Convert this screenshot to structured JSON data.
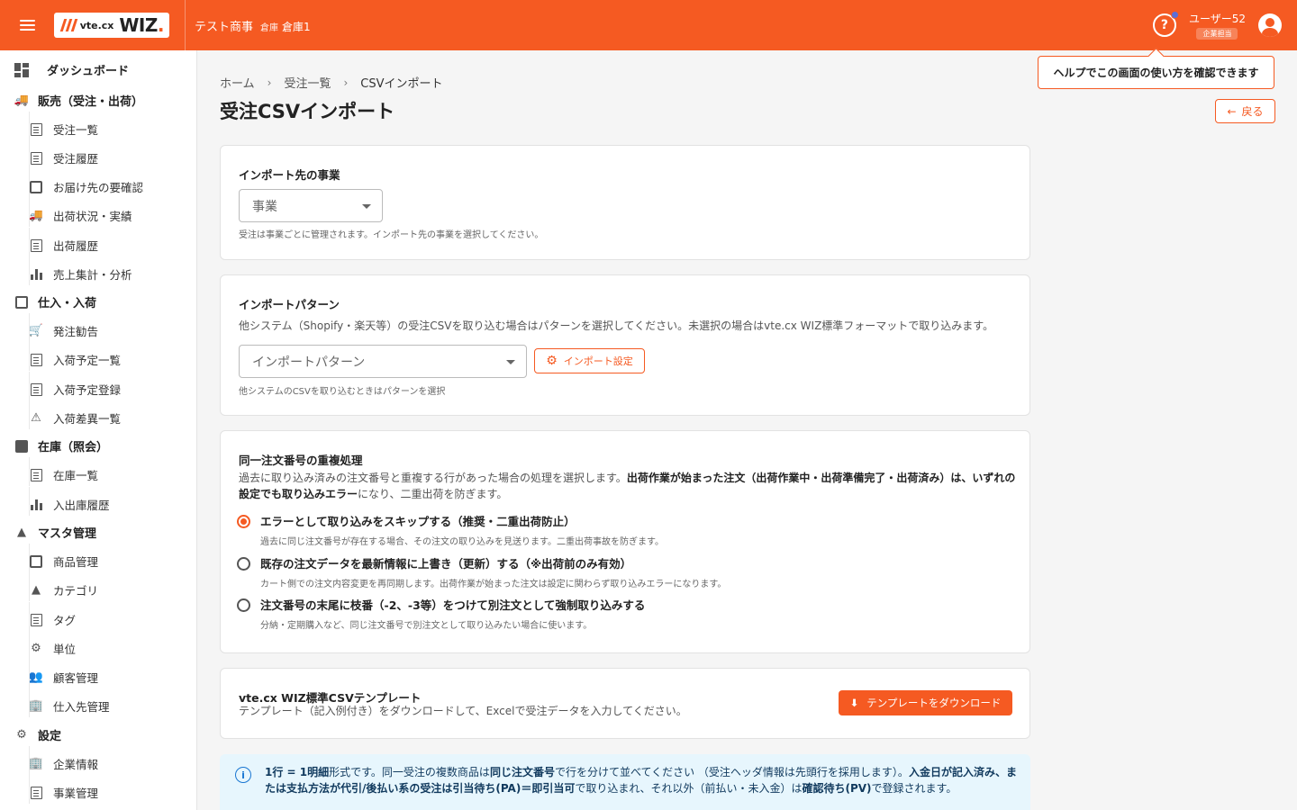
{
  "header": {
    "logo_small": "vte.cx",
    "logo_big": "WIZ",
    "company": "テスト商事",
    "warehouse_label": "倉庫",
    "warehouse": "倉庫1",
    "user_name": "ユーザー52",
    "user_role": "企業担当",
    "help_tooltip": "ヘルプでこの画面の使い方を確認できます",
    "accent_color": "#f55a22"
  },
  "sidebar": {
    "dashboard": "ダッシュボード",
    "groups": [
      {
        "label": "販売（受注・出荷）",
        "icon": "truck-icon",
        "items": [
          "受注一覧",
          "受注履歴",
          "お届け先の要確認",
          "出荷状況・実績",
          "出荷履歴",
          "売上集計・分析"
        ]
      },
      {
        "label": "仕入・入荷",
        "icon": "inbox-icon",
        "items": [
          "発注勧告",
          "入荷予定一覧",
          "入荷予定登録",
          "入荷差異一覧"
        ]
      },
      {
        "label": "在庫（照会）",
        "icon": "archive-icon",
        "items": [
          "在庫一覧",
          "入出庫履歴"
        ]
      },
      {
        "label": "マスタ管理",
        "icon": "category-icon",
        "items": [
          "商品管理",
          "カテゴリ",
          "タグ",
          "単位",
          "顧客管理",
          "仕入先管理"
        ]
      },
      {
        "label": "設定",
        "icon": "settings-icon",
        "items": [
          "企業情報",
          "事業管理"
        ]
      }
    ]
  },
  "breadcrumb": {
    "home": "ホーム",
    "list": "受注一覧",
    "current": "CSVインポート"
  },
  "page": {
    "title": "受注CSVインポート",
    "back": "戻る"
  },
  "business": {
    "title": "インポート先の事業",
    "placeholder": "事業",
    "hint": "受注は事業ごとに管理されます。インポート先の事業を選択してください。"
  },
  "pattern": {
    "title": "インポートパターン",
    "desc": "他システム（Shopify・楽天等）の受注CSVを取り込む場合はパターンを選択してください。未選択の場合はvte.cx WIZ標準フォーマットで取り込みます。",
    "placeholder": "インポートパターン",
    "settings_button": "インポート設定",
    "hint": "他システムのCSVを取り込むときはパターンを選択"
  },
  "duplicate": {
    "title": "同一注文番号の重複処理",
    "desc_normal": "過去に取り込み済みの注文番号と重複する行があった場合の処理を選択します。",
    "desc_bold": "出荷作業が始まった注文（出荷作業中・出荷準備完了・出荷済み）は、いずれの設定でも取り込みエラー",
    "desc_tail": "になり、二重出荷を防ぎます。",
    "options": [
      {
        "label": "エラーとして取り込みをスキップする（推奨・二重出荷防止）",
        "sub": "過去に同じ注文番号が存在する場合、その注文の取り込みを見送ります。二重出荷事故を防ぎます。",
        "selected": true
      },
      {
        "label": "既存の注文データを最新情報に上書き（更新）する（※出荷前のみ有効）",
        "sub": "カート側での注文内容変更を再同期します。出荷作業が始まった注文は設定に関わらず取り込みエラーになります。",
        "selected": false
      },
      {
        "label": "注文番号の末尾に枝番（-2、-3等）をつけて別注文として強制取り込みする",
        "sub": "分納・定期購入など、同じ注文番号で別注文として取り込みたい場合に使います。",
        "selected": false
      }
    ]
  },
  "template": {
    "title": "vte.cx WIZ標準CSVテンプレート",
    "desc": "テンプレート（記入例付き）をダウンロードして、Excelで受注データを入力してください。",
    "button": "テンプレートをダウンロード"
  },
  "info": {
    "p1": "1行 = 1明細",
    "p2": "形式です。同一受注の複数商品は",
    "p3": "同じ注文番号",
    "p4": "で行を分けて並べてください （受注ヘッダ情報は先頭行を採用します）。",
    "p5": "入金日が記入済み、または支払方法が代引/後払い系の受注は引当待ち(PA)＝即引当可",
    "p6": "で取り込まれ、それ以外（前払い・未入金）は",
    "p7": "確認待ち(PV)",
    "p8": "で登録されます。"
  }
}
